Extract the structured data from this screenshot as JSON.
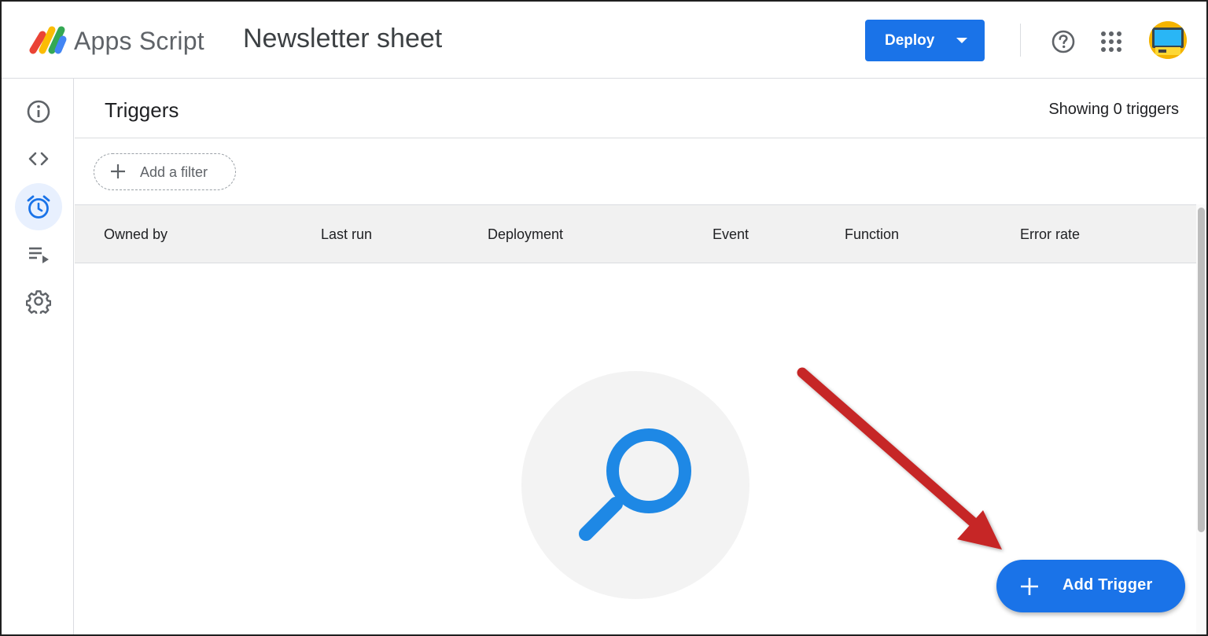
{
  "header": {
    "app_name": "Apps Script",
    "project_title": "Newsletter sheet",
    "deploy_label": "Deploy"
  },
  "rail": {
    "items": [
      {
        "icon": "info-icon",
        "label": "Overview"
      },
      {
        "icon": "code-icon",
        "label": "Editor"
      },
      {
        "icon": "alarm-clock-icon",
        "label": "Triggers",
        "active": true
      },
      {
        "icon": "executions-icon",
        "label": "Executions"
      },
      {
        "icon": "gear-icon",
        "label": "Project Settings"
      }
    ]
  },
  "main": {
    "title": "Triggers",
    "count_text": "Showing 0 triggers",
    "filter_label": "Add a filter",
    "columns": [
      "Owned by",
      "Last run",
      "Deployment",
      "Event",
      "Function",
      "Error rate"
    ],
    "rows": []
  },
  "fab": {
    "label": "Add Trigger"
  },
  "colors": {
    "accent": "#1a73e8",
    "annotation_arrow": "#c62828",
    "empty_state_icon": "#1e88e5"
  }
}
